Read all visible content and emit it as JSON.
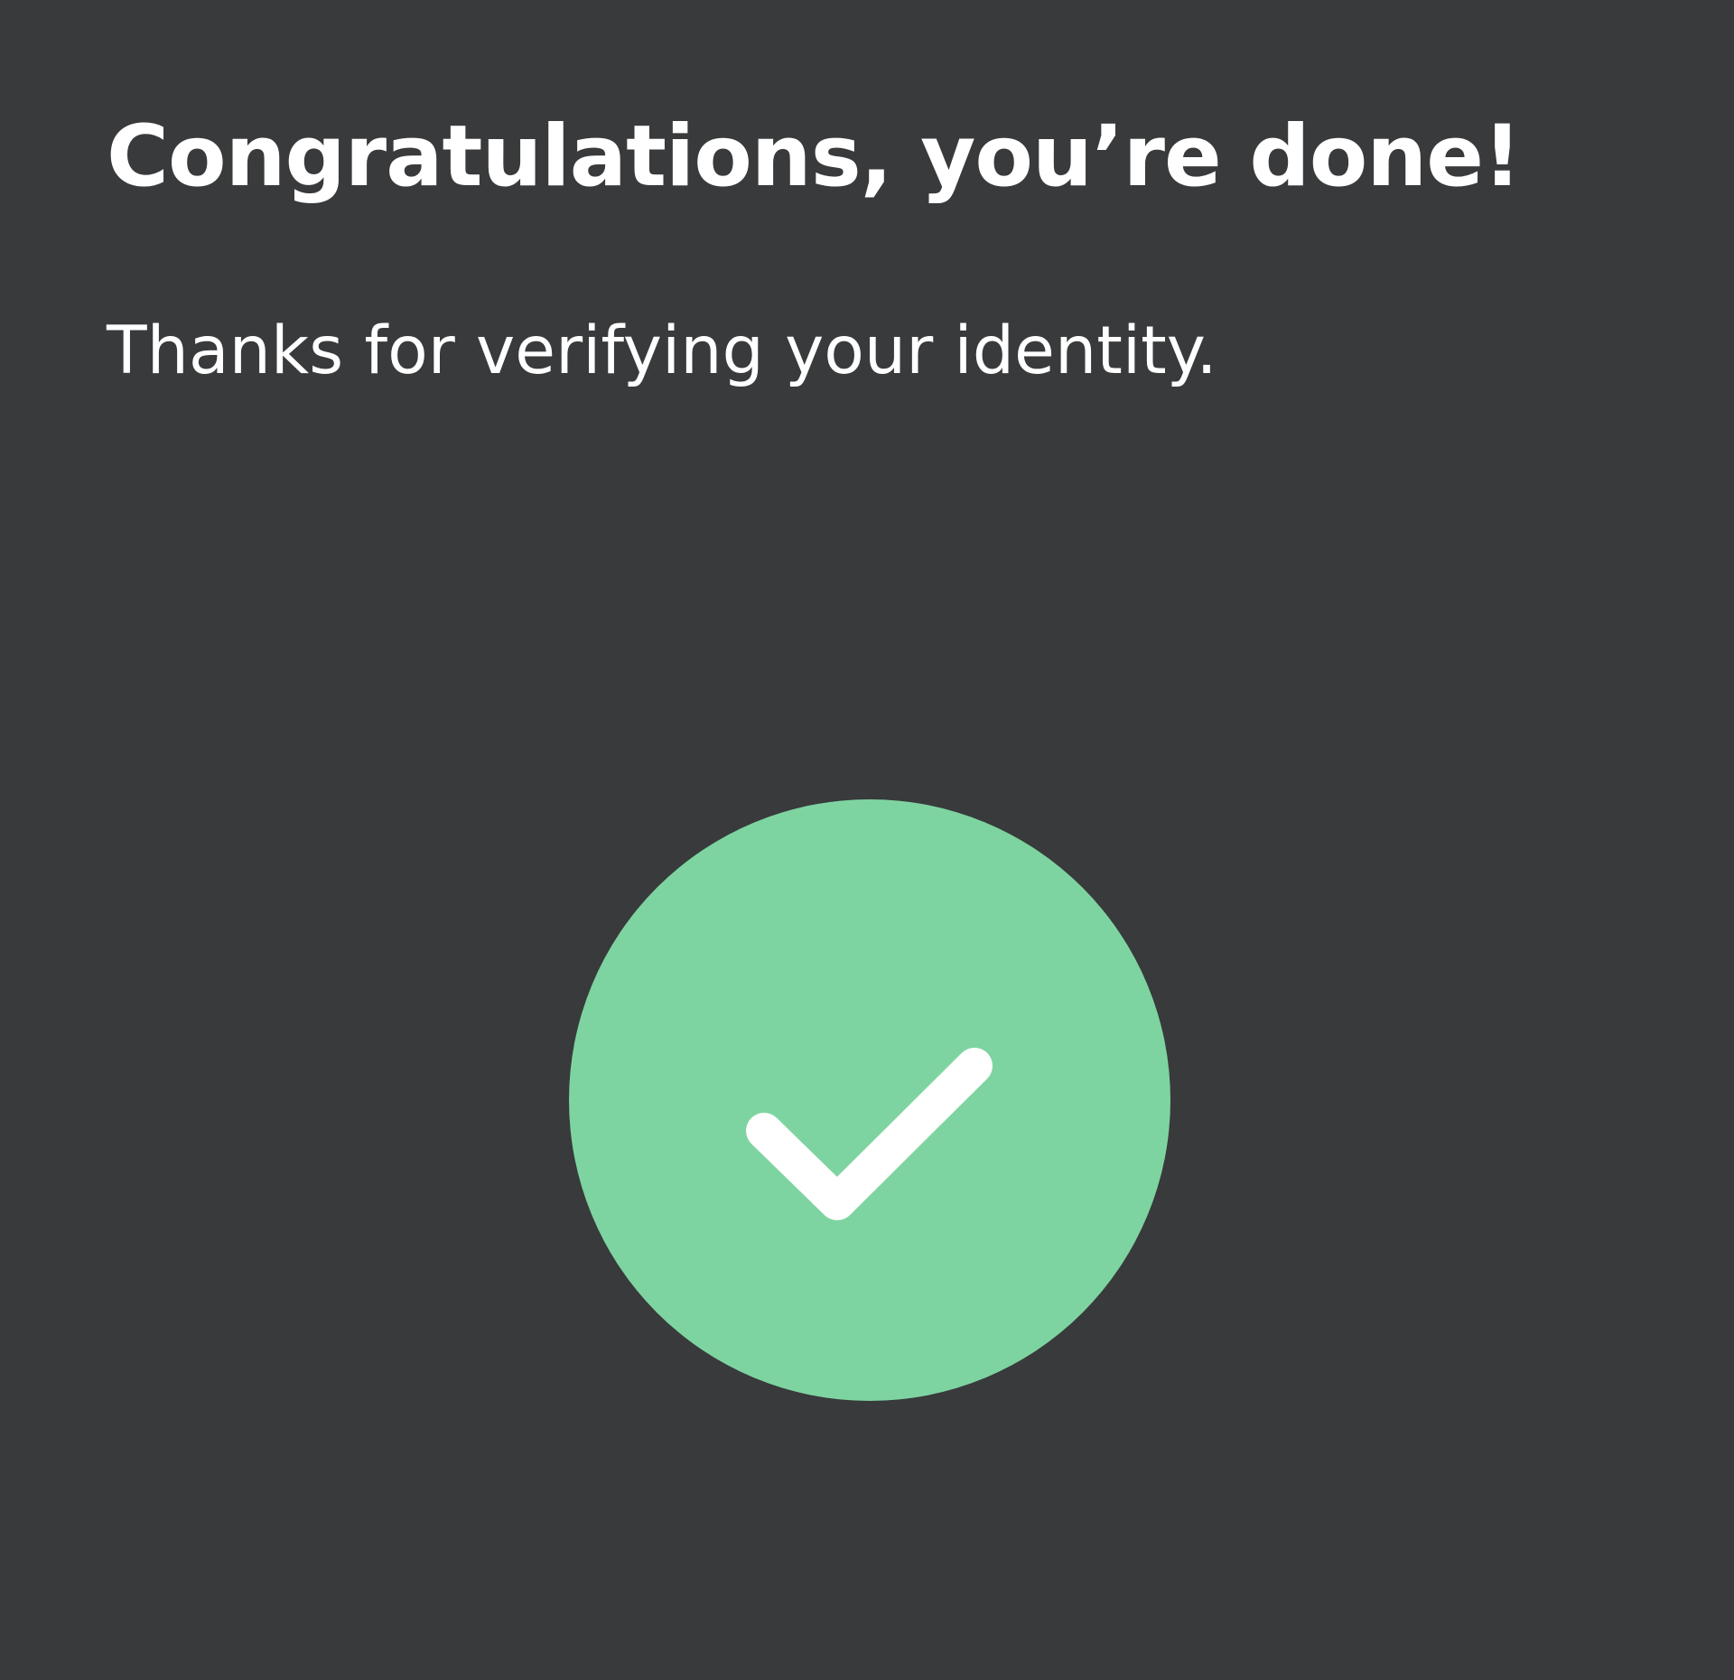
{
  "screen": {
    "title": "Congratulations, you’re done!",
    "message": "Thanks for verifying your identity."
  },
  "status": {
    "icon": "check-icon",
    "circle_color": "#7ed4a0",
    "check_color": "#ffffff"
  },
  "colors": {
    "background": "#383a3c",
    "text": "#ffffff"
  }
}
